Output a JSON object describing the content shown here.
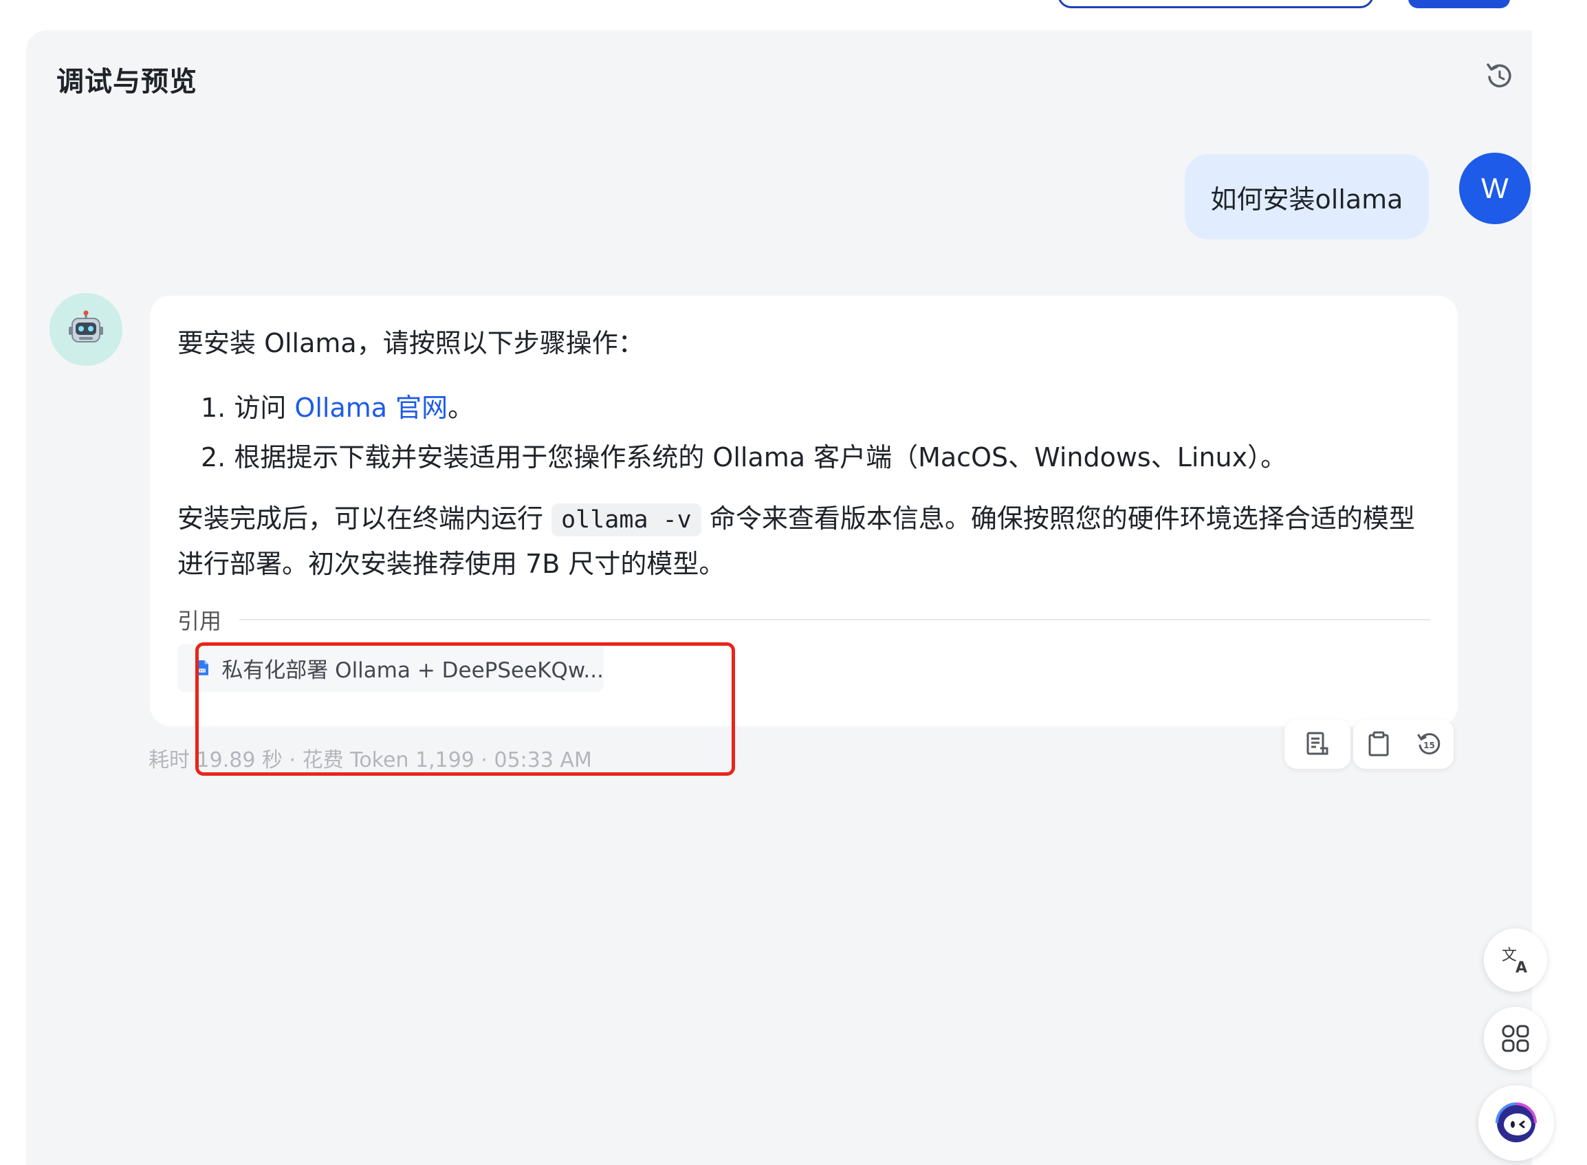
{
  "panel": {
    "title": "调试与预览"
  },
  "user_message": {
    "text": "如何安装ollama",
    "avatar_initial": "W"
  },
  "bot_message": {
    "intro": "要安装 Ollama，请按照以下步骤操作：",
    "steps": [
      {
        "prefix": "1. 访问 ",
        "link": "Ollama 官网",
        "suffix": "。"
      },
      {
        "text": "2. 根据提示下载并安装适用于您操作系统的 Ollama 客户端（MacOS、Windows、Linux）。"
      }
    ],
    "para_before_code": "安装完成后，可以在终端内运行 ",
    "code": "ollama -v",
    "para_after_code": " 命令来查看版本信息。确保按照您的硬件环境选择合适的模型进行部署。初次安装推荐使用 7B 尺寸的模型。",
    "citation_label": "引用",
    "citation_doc": "私有化部署 Ollama + DeePSeeKQw..."
  },
  "meta": {
    "text": "耗时 19.89 秒 · 花费 Token 1,199 · 05:33 AM"
  },
  "colors": {
    "accent": "#1d5be8",
    "highlight_box": "#e8241b",
    "user_bubble": "#e1edfe",
    "panel_bg": "#f4f5f7"
  },
  "icons": {
    "refresh": "refresh-icon",
    "document": "doc-icon",
    "clipboard": "clipboard-icon",
    "history": "history-15-icon",
    "translate": "translate-icon",
    "apps": "apps-icon",
    "assistant": "assistant-icon",
    "bot": "robot-icon"
  }
}
